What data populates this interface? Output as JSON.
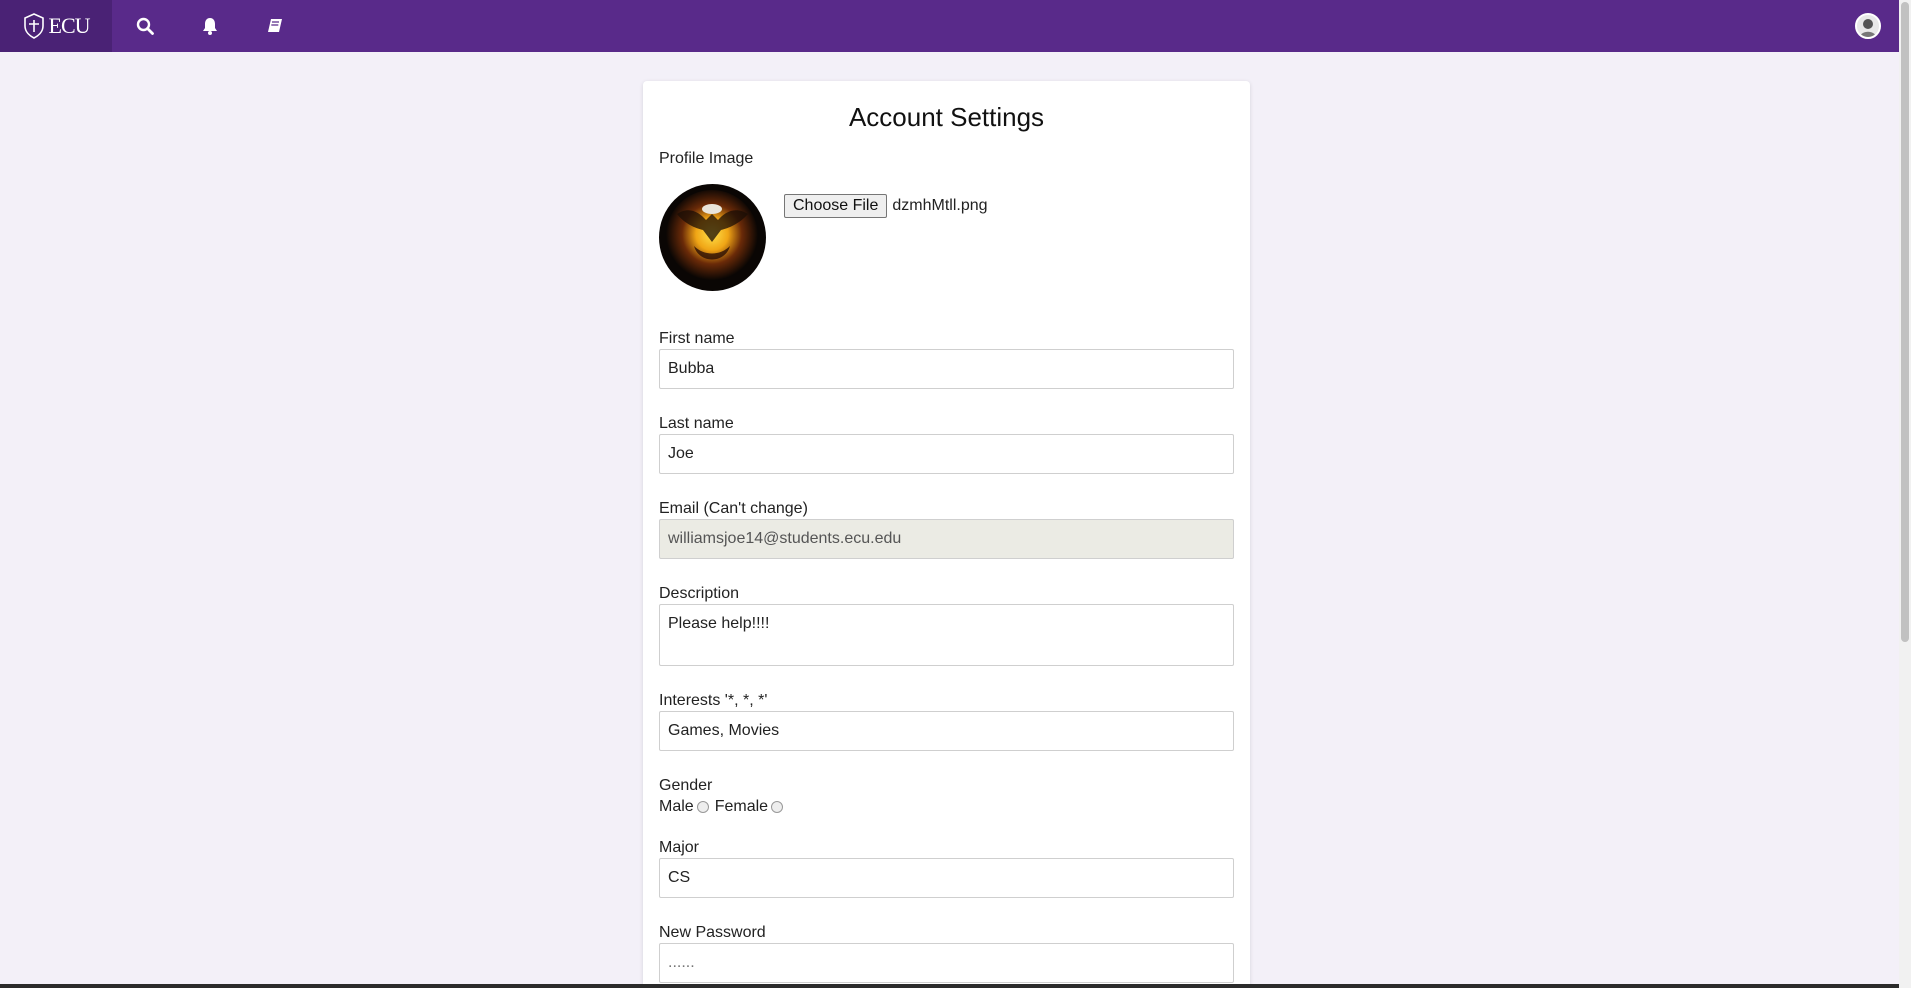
{
  "navbar": {
    "brand_text": "ECU",
    "icons": [
      "search-icon",
      "bell-icon",
      "book-icon"
    ],
    "bg_color": "#592a8a"
  },
  "form": {
    "title": "Account Settings",
    "profile_image_label": "Profile Image",
    "choose_file_label": "Choose File",
    "file_name": "dzmhMtll.png",
    "first_name_label": "First name",
    "first_name_value": "Bubba",
    "last_name_label": "Last name",
    "last_name_value": "Joe",
    "email_label": "Email (Can't change)",
    "email_value": "williamsjoe14@students.ecu.edu",
    "description_label": "Description",
    "description_value": "Please help!!!!",
    "interests_label": "Interests '*, *, *'",
    "interests_value": "Games, Movies",
    "gender_label": "Gender",
    "gender_male": "Male",
    "gender_female": "Female",
    "major_label": "Major",
    "major_value": "CS",
    "new_password_label": "New Password",
    "new_password_placeholder": "......"
  }
}
